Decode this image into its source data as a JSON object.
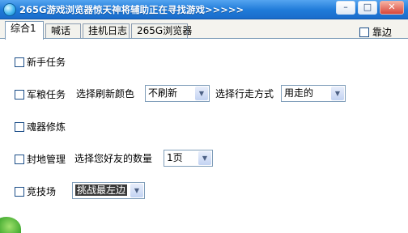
{
  "window": {
    "title": "265G游戏浏览器惊天神将辅助正在寻找游戏>>>>>",
    "min_glyph": "–",
    "max_glyph": "□",
    "close_glyph": "✕"
  },
  "tabs": [
    "综合1",
    "喊话",
    "挂机日志",
    "265G浏览器"
  ],
  "dock_label": "靠边",
  "rows": {
    "newbie": {
      "label": "新手任务"
    },
    "army": {
      "label": "军粮任务",
      "refresh_color_label": "选择刷新颜色",
      "refresh_color_value": "不刷新",
      "move_mode_label": "选择行走方式",
      "move_mode_value": "用走的"
    },
    "soul": {
      "label": "魂器修炼"
    },
    "fief": {
      "label": "封地管理",
      "friend_count_label": "选择您好友的数量",
      "friend_count_value": "1页"
    },
    "arena": {
      "label": "竞技场",
      "challenge_value": "挑战最左边"
    }
  },
  "icons": {
    "app": "globe-icon",
    "dropdown": "chevron-down-icon"
  }
}
